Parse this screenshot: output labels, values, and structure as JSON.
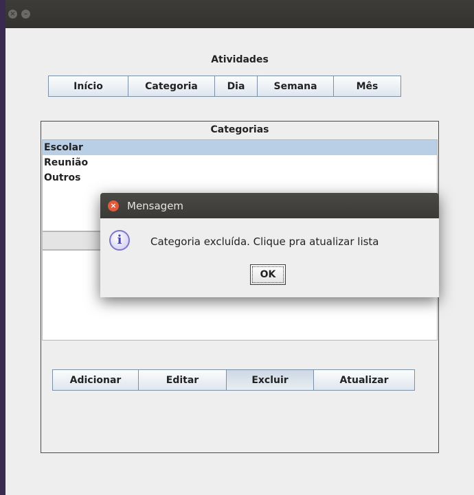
{
  "window": {
    "title_label": "Atividades"
  },
  "nav": {
    "tabs": [
      "Início",
      "Categoria",
      "Dia",
      "Semana",
      "Mês"
    ]
  },
  "categories": {
    "header": "Categorias",
    "items": [
      "Escolar",
      "Reunião",
      "Outros"
    ],
    "selected_index": 0
  },
  "actions": {
    "add": "Adicionar",
    "edit": "Editar",
    "delete": "Excluir",
    "refresh": "Atualizar"
  },
  "dialog": {
    "title": "Mensagem",
    "icon_glyph": "i",
    "message": "Categoria excluída. Clique pra atualizar lista",
    "ok_label": "OK"
  },
  "colors": {
    "selection": "#b8cfe5",
    "close_button": "#e25a3a",
    "info_icon": "#7c78c9"
  }
}
